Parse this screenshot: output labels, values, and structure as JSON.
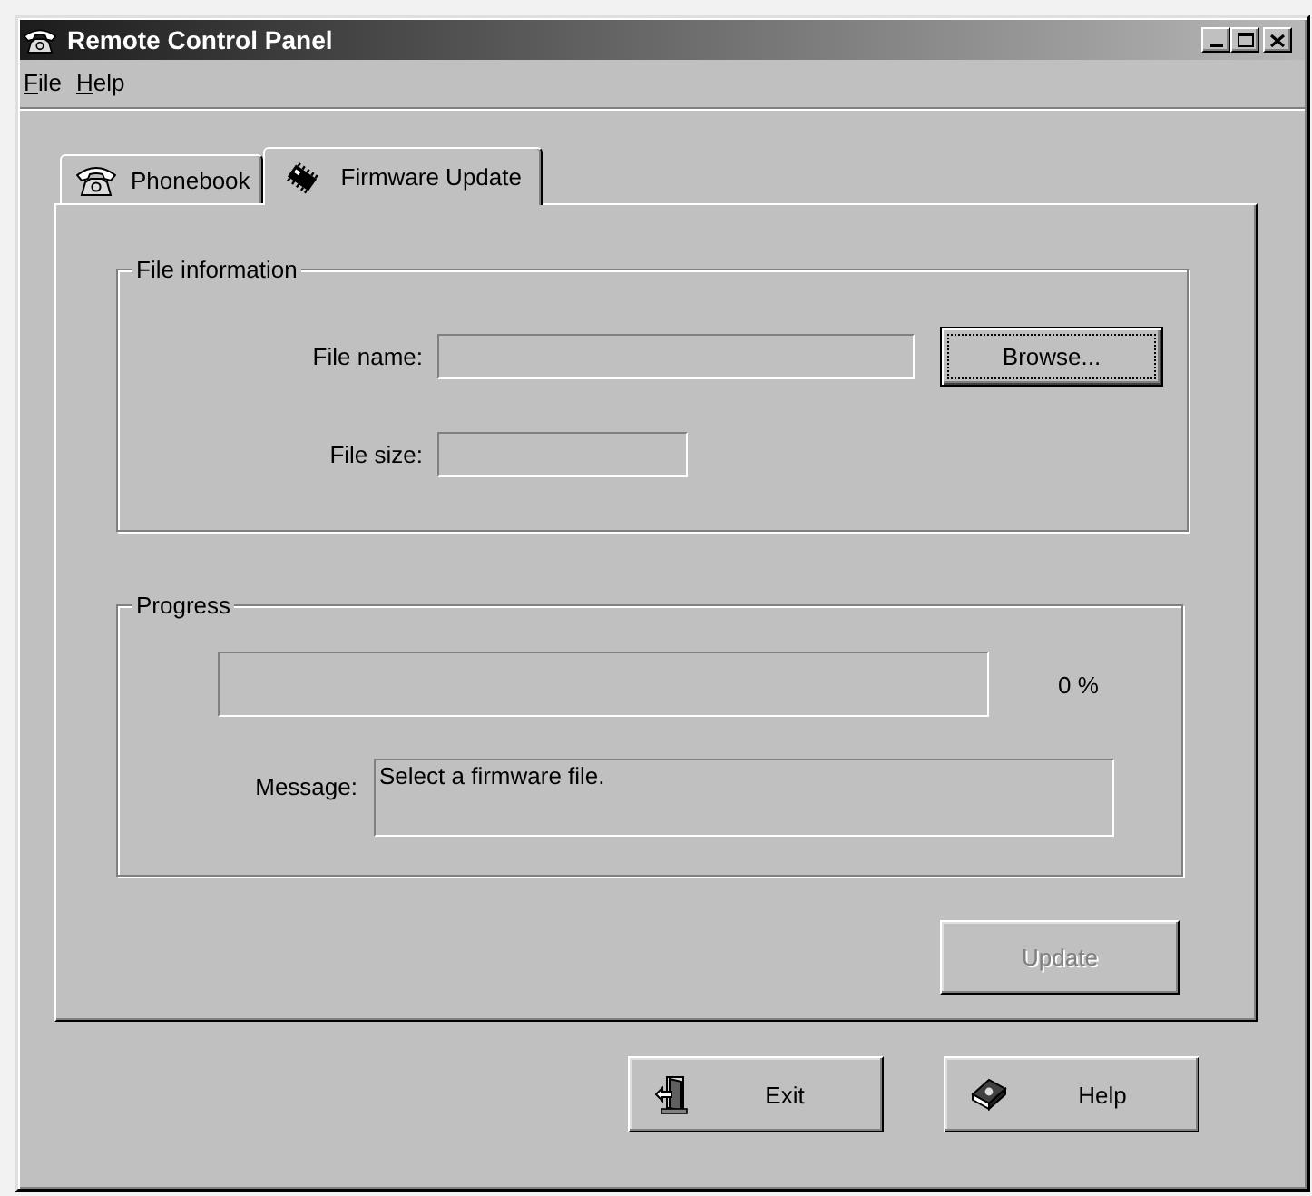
{
  "window": {
    "title": "Remote Control Panel"
  },
  "menu": [
    {
      "label": "File"
    },
    {
      "label": "Help"
    }
  ],
  "tabs": [
    {
      "label": "Phonebook",
      "kind": "phonebook",
      "selected": false
    },
    {
      "label": "Firmware Update",
      "kind": "firmware",
      "selected": true
    }
  ],
  "file_information": {
    "title": "File information",
    "file_name": {
      "label": "File name:",
      "disabled": true
    },
    "file_size": {
      "label": "File size:",
      "disabled": true
    },
    "browse_button": {
      "label": "Browse...",
      "default": true,
      "focused": true
    }
  },
  "progress": {
    "title": "Progress",
    "level": 0,
    "reading": "0 %",
    "message": {
      "label": "Message:",
      "value": "Select a firmware file.",
      "disabled": true
    }
  },
  "update_button": {
    "label": "Update",
    "disabled": true
  },
  "buttons": [
    {
      "kind": "exit",
      "label": "Exit"
    },
    {
      "kind": "help",
      "label": "Help"
    }
  ]
}
